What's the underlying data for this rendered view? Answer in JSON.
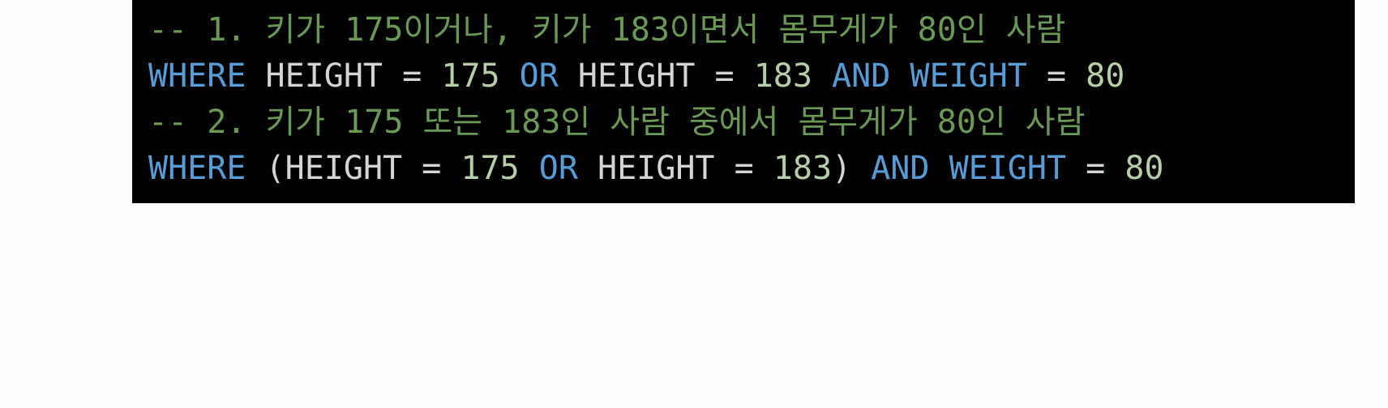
{
  "colors": {
    "background": "#000000",
    "comment": "#6a9955",
    "keyword": "#569cd6",
    "number": "#b5cea8",
    "identifier": "#d4d4d4",
    "page": "#fdfdfd"
  },
  "code": {
    "line1_comment": "-- 1. 키가 175이거나, 키가 183이면서 몸무게가 80인 사람",
    "line2": {
      "kw_where": "WHERE",
      "id_height_1": "HEIGHT",
      "op_eq_1": "=",
      "num_175": "175",
      "kw_or": "OR",
      "id_height_2": "HEIGHT",
      "op_eq_2": "=",
      "num_183": "183",
      "kw_and": "AND",
      "kw_weight": "WEIGHT",
      "op_eq_3": "=",
      "num_80": "80"
    },
    "line3_comment": "-- 2. 키가 175 또는 183인 사람 중에서 몸무게가 80인 사람",
    "line4": {
      "kw_where": "WHERE",
      "paren_open": "(",
      "id_height_1": "HEIGHT",
      "op_eq_1": "=",
      "num_175": "175",
      "kw_or": "OR",
      "id_height_2": "HEIGHT",
      "op_eq_2": "=",
      "num_183": "183",
      "paren_close": ")",
      "kw_and": "AND",
      "kw_weight": "WEIGHT",
      "op_eq_3": "=",
      "num_80": "80"
    }
  }
}
